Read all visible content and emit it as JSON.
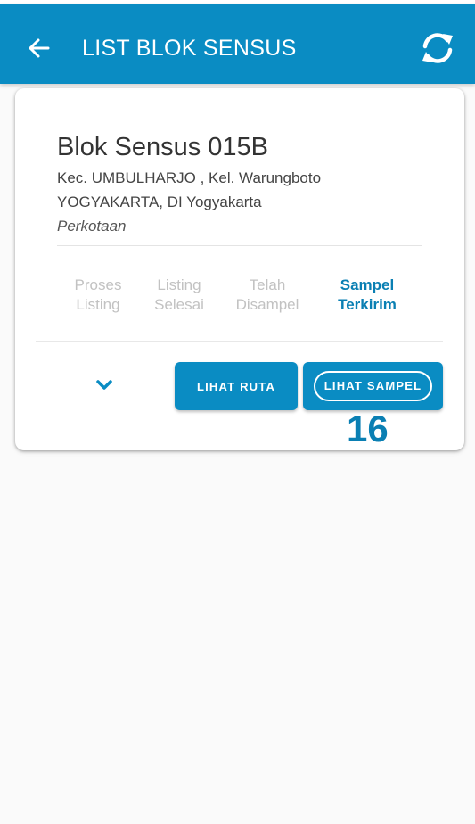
{
  "header": {
    "title": "LIST BLOK SENSUS",
    "back_icon": "arrow-left-icon",
    "sync_icon": "sync-icon",
    "background_color": "#0a8cc3"
  },
  "card": {
    "title": "Blok Sensus 015B",
    "address_line1": "Kec. UMBULHARJO , Kel. Warungboto",
    "address_line2": "YOGYAKARTA, DI Yogyakarta",
    "area_type": "Perkotaan",
    "steps": [
      {
        "line1": "Proses",
        "line2": "Listing",
        "active": false
      },
      {
        "line1": "Listing",
        "line2": "Selesai",
        "active": false
      },
      {
        "line1": "Telah",
        "line2": "Disampel",
        "active": false
      },
      {
        "line1": "Sampel",
        "line2": "Terkirim",
        "active": true
      }
    ],
    "expand_icon": "chevron-down-icon",
    "lihat_ruta_label": "LIHAT RUTA",
    "lihat_sampel_label": "LIHAT SAMPEL",
    "sampel_count": "16",
    "accent_color": "#0a7fb3"
  }
}
